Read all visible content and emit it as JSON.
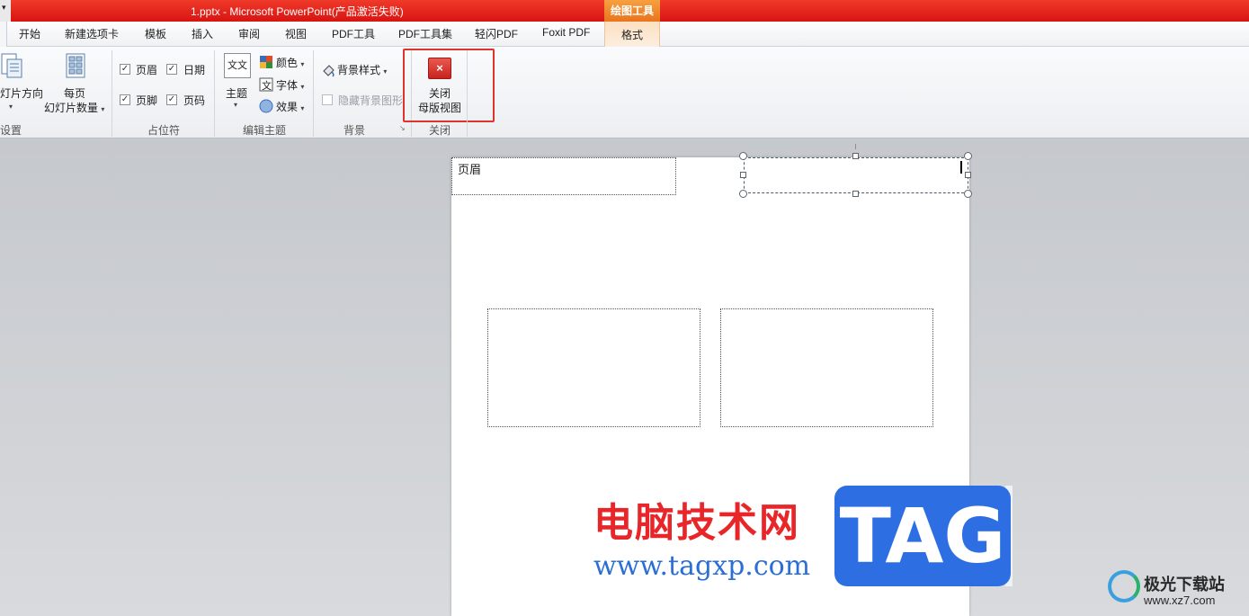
{
  "window": {
    "title": "1.pptx  -  Microsoft PowerPoint(产品激活失败)",
    "context_tool_group": "绘图工具",
    "quick_access_glyph": "▾"
  },
  "tabs": [
    "开始",
    "新建选项卡",
    "模板",
    "插入",
    "审阅",
    "视图",
    "PDF工具",
    "PDF工具集",
    "轻闪PDF",
    "Foxit PDF"
  ],
  "context_tab": "格式",
  "ribbon": {
    "page_setup": {
      "orientation_label": "灯片方向",
      "slides_per_page_line1": "每页",
      "slides_per_page_line2": "幻灯片数量",
      "group_label": "设置"
    },
    "placeholders": {
      "header": "页眉",
      "date": "日期",
      "footer": "页脚",
      "page_number": "页码",
      "header_checked": true,
      "date_checked": true,
      "footer_checked": true,
      "page_number_checked": true,
      "group_label": "占位符"
    },
    "edit_theme": {
      "theme_label": "主题",
      "theme_icon_text": "文文",
      "colors_label": "颜色",
      "fonts_label": "字体",
      "effects_label": "效果",
      "group_label": "编辑主题"
    },
    "background": {
      "background_styles_label": "背景样式",
      "hide_background_label": "隐藏背景图形",
      "group_label": "背景"
    },
    "close": {
      "close_line1": "关闭",
      "close_line2": "母版视图",
      "icon_glyph": "×",
      "group_label": "关闭"
    }
  },
  "slide": {
    "header_placeholder_text": "页眉"
  },
  "watermark": {
    "site_name": "电脑技术网",
    "site_url": "www.tagxp.com",
    "tag_text": "TAG",
    "download_site": "极光下载站",
    "download_url": "www.xz7.com"
  },
  "colors": {
    "title_bar": "#d81411",
    "context_tab": "#e9731d",
    "highlight_box": "#e0332c",
    "tag_blue": "#2d6fe3"
  }
}
